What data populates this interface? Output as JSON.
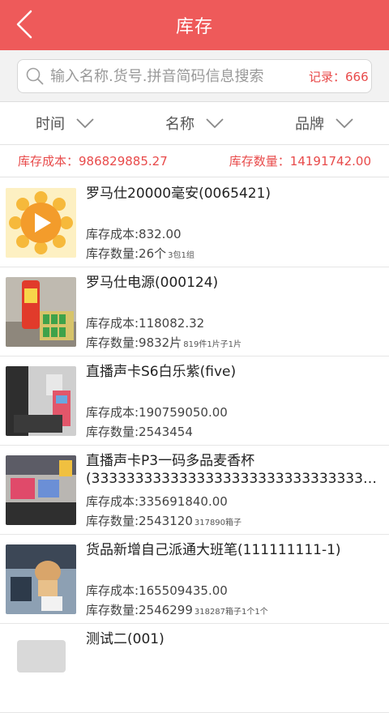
{
  "header": {
    "title": "库存"
  },
  "search": {
    "placeholder": "输入名称.货号.拼音简码信息搜索",
    "records": "记录：666"
  },
  "filters": [
    {
      "label": "时间"
    },
    {
      "label": "名称"
    },
    {
      "label": "品牌"
    }
  ],
  "summary": {
    "cost": "库存成本：986829885.27",
    "qty": "库存数量：14191742.00"
  },
  "items": [
    {
      "name": "罗马仕20000毫安(0065421)",
      "cost": "库存成本:832.00",
      "qty": "库存数量:26个",
      "unit": "3包1组"
    },
    {
      "name": "罗马仕电源(000124)",
      "cost": "库存成本:118082.32",
      "qty": "库存数量:9832片",
      "unit": "819件1片子1片"
    },
    {
      "name": "直播声卡S6白乐紫(five)",
      "cost": "库存成本:190759050.00",
      "qty": "库存数量:2543454",
      "unit": ""
    },
    {
      "name": "直播声卡P3一码多品麦香杯",
      "name_line2": "(333333333333333333333333333333333...",
      "cost": "库存成本:335691840.00",
      "qty": "库存数量:2543120",
      "unit": "317890箱子"
    },
    {
      "name": "货品新增自己派通大班笔(111111111-1)",
      "cost": "库存成本:165509435.00",
      "qty": "库存数量:2546299",
      "unit": "318287箱子1个1个"
    },
    {
      "name": "测试二(001)",
      "cost": "",
      "qty": "",
      "unit": ""
    }
  ],
  "colors": {
    "accent": "#ee5a5a",
    "summary_text": "#e84a4a"
  },
  "icons": {
    "back": "back-arrow-icon",
    "search": "search-icon",
    "chevron": "chevron-down-icon",
    "placeholder_image": "play-sun-icon"
  }
}
